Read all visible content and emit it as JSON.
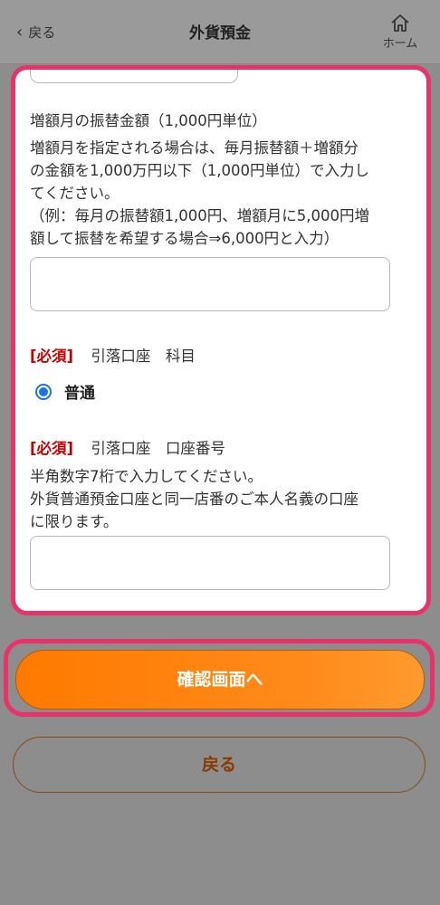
{
  "header": {
    "back_label": "戻る",
    "title": "外貨預金",
    "home_label": "ホーム"
  },
  "form": {
    "increase_amount": {
      "label": "増額月の振替金額（1,000円単位）",
      "desc_lines": [
        "増額月を指定される場合は、毎月振替額＋増額分",
        "の金額を1,000万円以下（1,000円単位）で入力し",
        "てください。",
        "（例：毎月の振替額1,000円、増額月に5,000円増",
        "額して振替を希望する場合⇒6,000円と入力）"
      ],
      "value": ""
    },
    "account_type": {
      "required": "[必須]",
      "label": "引落口座　科目",
      "selected": "普通"
    },
    "account_number": {
      "required": "[必須]",
      "label": "引落口座　口座番号",
      "desc_lines": [
        "半角数字7桁で入力してください。",
        "外貨普通預金口座と同一店番のご本人名義の口座",
        "に限ります。"
      ],
      "value": ""
    }
  },
  "buttons": {
    "confirm_label": "確認画面へ",
    "back_label": "戻る"
  },
  "colors": {
    "accent": "#ff7a00",
    "highlight": "#e8336a",
    "required": "#c80000",
    "radio": "#1a73e8"
  }
}
